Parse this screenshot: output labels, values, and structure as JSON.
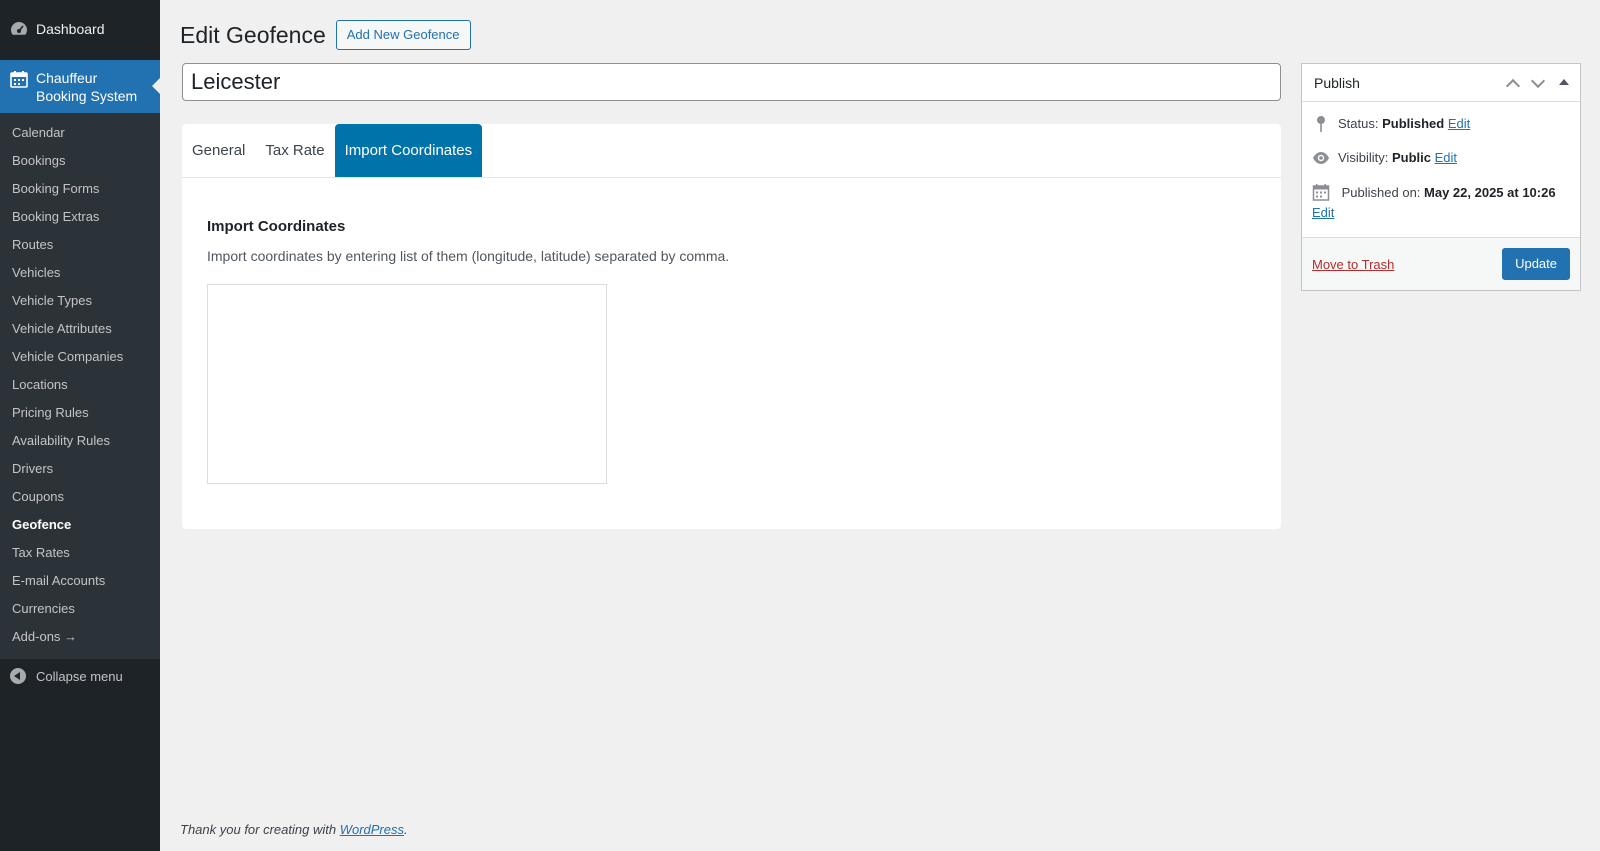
{
  "sidebar": {
    "dashboard_label": "Dashboard",
    "current_label": "Chauffeur Booking System",
    "items": [
      {
        "label": "Calendar"
      },
      {
        "label": "Bookings"
      },
      {
        "label": "Booking Forms"
      },
      {
        "label": "Booking Extras"
      },
      {
        "label": "Routes"
      },
      {
        "label": "Vehicles"
      },
      {
        "label": "Vehicle Types"
      },
      {
        "label": "Vehicle Attributes"
      },
      {
        "label": "Vehicle Companies"
      },
      {
        "label": "Locations"
      },
      {
        "label": "Pricing Rules"
      },
      {
        "label": "Availability Rules"
      },
      {
        "label": "Drivers"
      },
      {
        "label": "Coupons"
      },
      {
        "label": "Geofence"
      },
      {
        "label": "Tax Rates"
      },
      {
        "label": "E-mail Accounts"
      },
      {
        "label": "Currencies"
      },
      {
        "label": "Add-ons →"
      }
    ],
    "active_item": "Geofence",
    "collapse_label": "Collapse menu"
  },
  "header": {
    "title": "Edit Geofence",
    "add_new_label": "Add New Geofence"
  },
  "post_title": "Leicester",
  "tabs": [
    {
      "label": "General"
    },
    {
      "label": "Tax Rate"
    },
    {
      "label": "Import Coordinates"
    }
  ],
  "active_tab": "Import Coordinates",
  "import_section": {
    "heading": "Import Coordinates",
    "description": "Import coordinates by entering list of them (longitude, latitude) separated by comma.",
    "textarea_value": ""
  },
  "publish_box": {
    "title": "Publish",
    "status_label": "Status:",
    "status_value": "Published",
    "visibility_label": "Visibility:",
    "visibility_value": "Public",
    "published_label": "Published on:",
    "published_value": "May 22, 2025 at 10:26",
    "edit_label": "Edit",
    "trash_label": "Move to Trash",
    "update_label": "Update"
  },
  "footer": {
    "text_before": "Thank you for creating with ",
    "link_label": "WordPress",
    "text_after": "."
  },
  "colors": {
    "sidebar_bg": "#1d2327",
    "submenu_bg": "#2c3338",
    "accent": "#2271b1",
    "active_tab": "#0073aa",
    "trash": "#b32d2e"
  }
}
